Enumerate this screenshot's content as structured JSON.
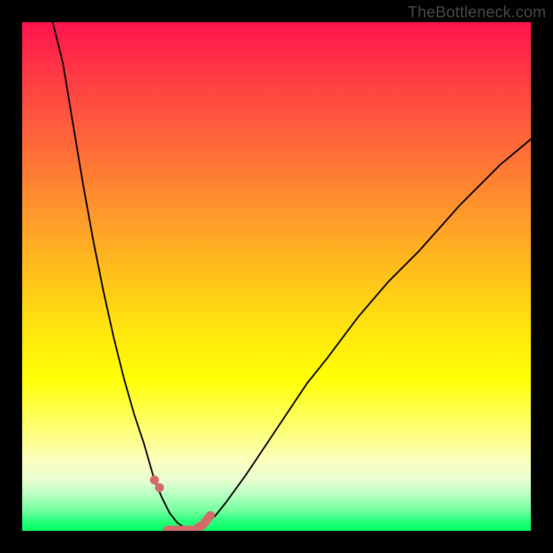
{
  "watermark": "TheBottleneck.com",
  "colors": {
    "frame": "#000000",
    "curve": "#000000",
    "marker": "#d46a6a",
    "gradient_stops": [
      "#ff134f",
      "#ff3146",
      "#ff5b3d",
      "#ff8b2f",
      "#ffb81f",
      "#ffe40f",
      "#ffff04",
      "#feff73",
      "#fbffbd",
      "#e8ffd0",
      "#b4ffc0",
      "#74ffa0",
      "#2aff7c",
      "#00ff66"
    ]
  },
  "chart_data": {
    "type": "line",
    "title": "",
    "xlabel": "",
    "ylabel": "",
    "xlim": [
      0,
      100
    ],
    "ylim": [
      0,
      100
    ],
    "grid": false,
    "legend": false,
    "annotations": [],
    "series": [
      {
        "name": "curve",
        "x": [
          6,
          8,
          10,
          12,
          14,
          16,
          18,
          20,
          22,
          24,
          26,
          27.5,
          29,
          30.5,
          32,
          33,
          34,
          36,
          38,
          40,
          44,
          48,
          52,
          56,
          60,
          66,
          72,
          78,
          86,
          94,
          100
        ],
        "y": [
          100,
          92,
          80,
          68,
          57,
          47,
          38,
          30,
          23,
          17,
          10,
          6.5,
          3.5,
          1.6,
          0.6,
          0.2,
          0.3,
          1.2,
          3,
          5.5,
          11,
          17,
          23,
          29,
          34,
          42,
          49,
          55,
          64,
          72,
          77
        ]
      }
    ],
    "markers": {
      "name": "pink-dots",
      "x": [
        26,
        27,
        34.5,
        35,
        35.5,
        36,
        36.5,
        37
      ],
      "y": [
        10,
        8.5,
        0.6,
        0.9,
        1.2,
        1.8,
        2.4,
        3.0
      ]
    },
    "flat_segment": {
      "x": [
        28.5,
        33.5
      ],
      "y": [
        0.2,
        0.2
      ]
    }
  }
}
